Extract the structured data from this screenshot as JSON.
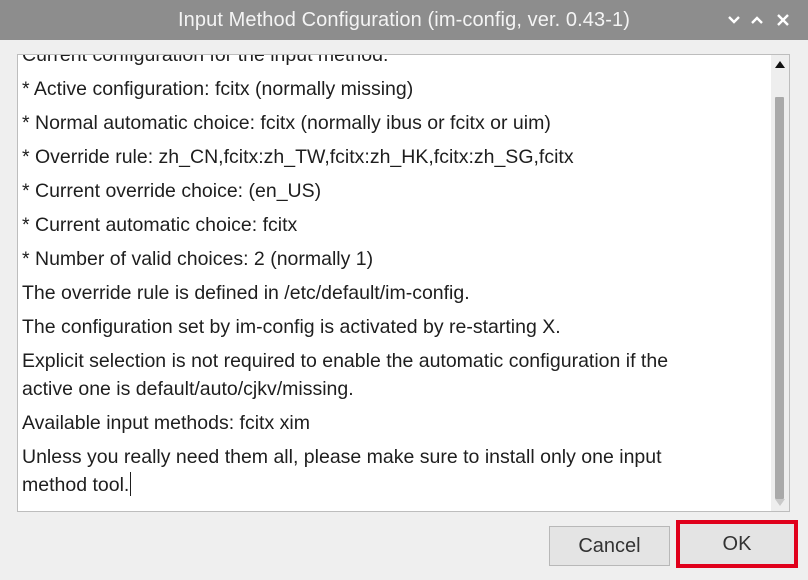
{
  "window": {
    "title": "Input Method Configuration (im-config, ver. 0.43-1)",
    "controls": {
      "minimize_icon": "chevron-down-icon",
      "maximize_icon": "chevron-up-icon",
      "close_icon": "close-icon"
    }
  },
  "text": {
    "partial_top_line": "Current configuration for the input method:",
    "lines": [
      " * Active configuration: fcitx (normally missing)",
      " * Normal automatic choice: fcitx (normally ibus or fcitx or uim)",
      " * Override rule: zh_CN,fcitx:zh_TW,fcitx:zh_HK,fcitx:zh_SG,fcitx",
      " * Current override choice:  (en_US)",
      " * Current automatic choice: fcitx",
      " * Number of valid choices: 2 (normally 1)",
      "The override rule is defined in /etc/default/im-config.",
      "The configuration set by im-config is activated by re-starting X.",
      "Explicit selection is not required to enable the automatic configuration if the",
      "active one is default/auto/cjkv/missing.",
      "  Available input methods: fcitx xim",
      "Unless you really need them all, please make sure to install only one input",
      "method tool."
    ]
  },
  "buttons": {
    "cancel": "Cancel",
    "ok": "OK"
  },
  "colors": {
    "titlebar": "#8d8d8d",
    "ok_highlight": "#e0001b"
  }
}
